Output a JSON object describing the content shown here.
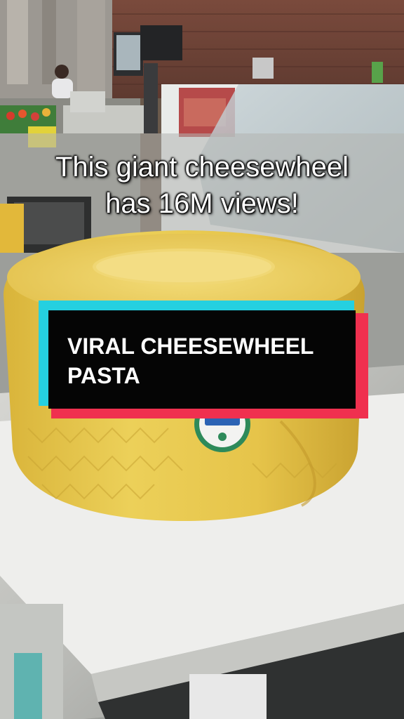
{
  "caption": {
    "line1": "This giant cheesewheel",
    "line2": "has 16M views!"
  },
  "banner": {
    "line1": "VIRAL CHEESEWHEEL",
    "line2": "PASTA"
  },
  "colors": {
    "banner_background": "#050505",
    "banner_cyan_edge": "#25d0e0",
    "banner_red_edge": "#f0304f",
    "cheese": "#e6c84a"
  }
}
